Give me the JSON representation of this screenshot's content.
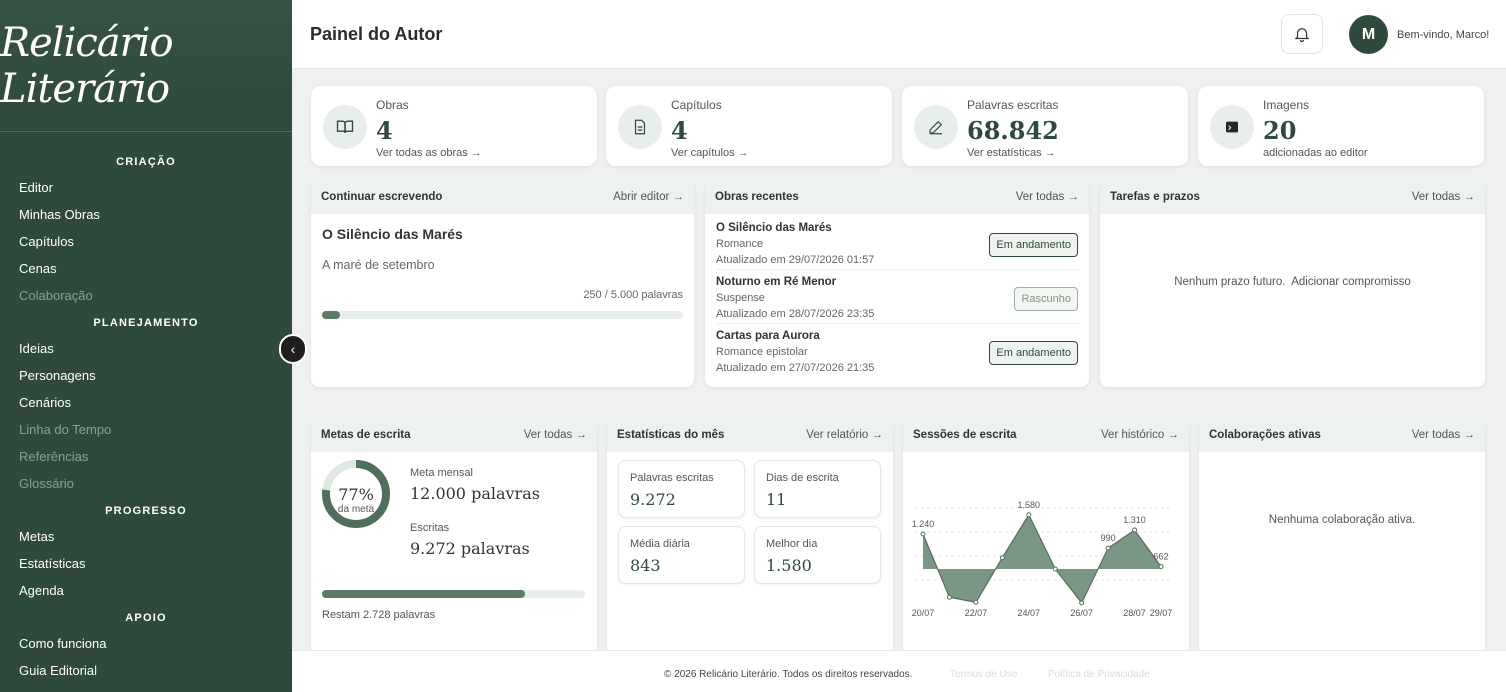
{
  "brand": {
    "name": "Relicário Literário"
  },
  "sidebar": {
    "sections": [
      {
        "title": "CRIAÇÃO",
        "items": [
          "Editor",
          "Minhas Obras",
          "Capítulos",
          "Cenas",
          "Colaboração"
        ]
      },
      {
        "title": "PLANEJAMENTO",
        "items": [
          "Ideias",
          "Personagens",
          "Cenários",
          "Linha do Tempo",
          "Referências",
          "Glossário"
        ]
      },
      {
        "title": "PROGRESSO",
        "items": [
          "Metas",
          "Estatísticas",
          "Agenda"
        ]
      },
      {
        "title": "APOIO",
        "items": [
          "Como funciona",
          "Guia Editorial"
        ]
      }
    ],
    "collapse_glyph": "‹"
  },
  "header": {
    "title": "Painel do Autor",
    "avatar_initial": "M",
    "welcome": "Bem-vindo, Marco!"
  },
  "stats": [
    {
      "label": "Obras",
      "value": "4",
      "link": "Ver todas as obras →",
      "icon": "book-icon"
    },
    {
      "label": "Capítulos",
      "value": "4",
      "link": "Ver capítulos →",
      "icon": "document-icon"
    },
    {
      "label": "Palavras escritas",
      "value": "68.842",
      "link": "Ver estatísticas →",
      "icon": "pencil-icon"
    },
    {
      "label": "Imagens",
      "value": "20",
      "link": "adicionadas ao editor",
      "icon": "image-icon"
    }
  ],
  "continue": {
    "title": "Continuar escrevendo",
    "link": "Abrir editor →",
    "work_title": "O Silêncio das Marés",
    "chapter": "A maré de setembro",
    "count": "250 / 5.000 palavras",
    "progress": 0.05
  },
  "recent": {
    "title": "Obras recentes",
    "link": "Ver todas →",
    "works": [
      {
        "title": "O Silêncio das Marés",
        "genre": "Romance",
        "updated": "Atualizado em 29/07/2026 01:57",
        "status": "Em andamento"
      },
      {
        "title": "Noturno em Ré Menor",
        "genre": "Suspense",
        "updated": "Atualizado em 28/07/2026 23:35",
        "status": "Rascunho"
      },
      {
        "title": "Cartas para Aurora",
        "genre": "Romance epistolar",
        "updated": "Atualizado em 27/07/2026 21:35",
        "status": "Em andamento"
      }
    ]
  },
  "tasks": {
    "title": "Tarefas e prazos",
    "link": "Ver todas →",
    "empty": "Nenhum prazo futuro.",
    "add": "Adicionar compromisso"
  },
  "goals": {
    "title": "Metas de escrita",
    "link": "Ver todas →",
    "percent": "77%",
    "percent_sub": "da meta",
    "percent_value": 0.77,
    "monthly_label": "Meta mensal",
    "monthly_value": "12.000 palavras",
    "written_label": "Escritas",
    "written_value": "9.272 palavras",
    "remaining": "Restam 2.728 palavras"
  },
  "month_stats": {
    "title": "Estatísticas do mês",
    "link": "Ver relatório →",
    "cards": [
      {
        "label": "Palavras escritas",
        "value": "9.272"
      },
      {
        "label": "Dias de escrita",
        "value": "11"
      },
      {
        "label": "Média diária",
        "value": "843"
      },
      {
        "label": "Melhor dia",
        "value": "1.580"
      }
    ]
  },
  "sessions": {
    "title": "Sessões de escrita",
    "link": "Ver histórico →"
  },
  "chart_data": {
    "type": "area",
    "x": [
      "20/07",
      "21/07",
      "22/07",
      "23/07",
      "24/07",
      "25/07",
      "26/07",
      "27/07",
      "28/07",
      "29/07"
    ],
    "x_tick_labels": [
      "20/07",
      "22/07",
      "24/07",
      "26/07",
      "28/07",
      "29/07"
    ],
    "values": [
      1240,
      120,
      30,
      820,
      1580,
      620,
      20,
      990,
      1310,
      662
    ],
    "data_labels": [
      "1.240",
      "",
      "",
      "",
      "1.580",
      "",
      "",
      "990",
      "1.310",
      "662"
    ],
    "ylim": [
      0,
      1700
    ],
    "color": "#6e8b78",
    "grid": true
  },
  "collab": {
    "title": "Colaborações ativas",
    "link": "Ver todas →",
    "empty": "Nenhuma colaboração ativa."
  },
  "footer": {
    "copyright": "© 2026 Relicário Literário. Todos os direitos reservados.",
    "terms": "Termos de Uso",
    "privacy": "Política de Privacidade"
  },
  "colors": {
    "primary": "#2f4a3c",
    "accent": "#5c7a67",
    "background": "#eef1ef"
  }
}
